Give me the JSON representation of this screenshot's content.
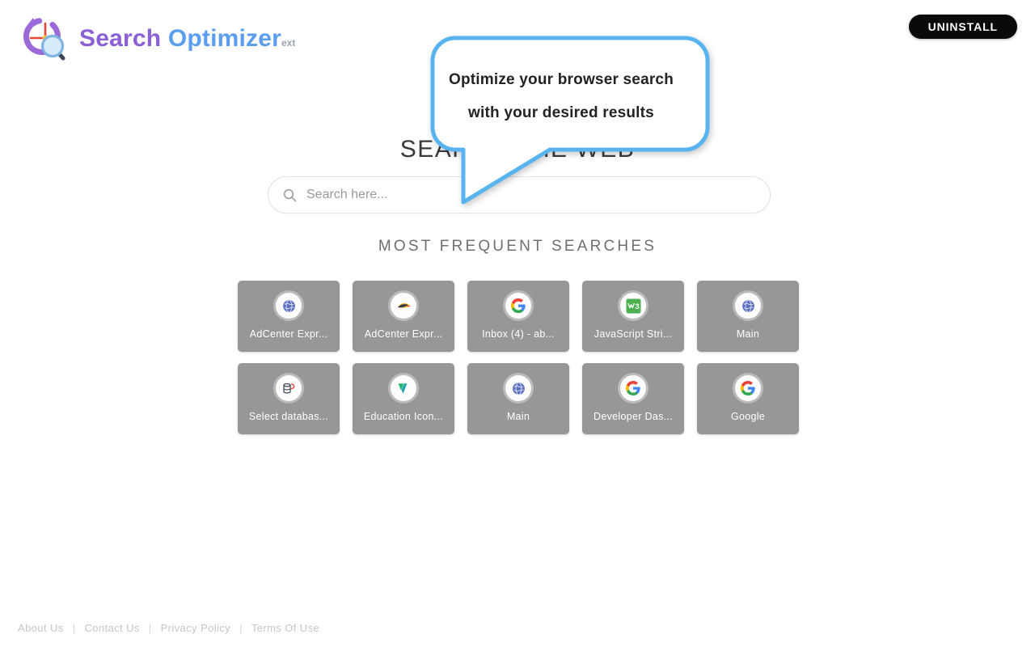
{
  "header": {
    "logo": {
      "icon_name": "search-history-logo-icon",
      "word1": "Search",
      "word2": "Optimizer",
      "suffix": "ext"
    },
    "uninstall_label": "UNINSTALL"
  },
  "tooltip": {
    "line1": "Optimize your browser search",
    "line2": "with your desired results",
    "border_color": "#58b4f0",
    "background": "#ffffff"
  },
  "main": {
    "heading": "SEARCH THE WEB",
    "search": {
      "placeholder": "Search here...",
      "value": "",
      "icon_name": "search-icon"
    },
    "frequent_heading": "MOST FREQUENT SEARCHES",
    "tiles": [
      {
        "label": "AdCenter Expr...",
        "icon": "globe-icon"
      },
      {
        "label": "AdCenter Expr...",
        "icon": "bird-icon"
      },
      {
        "label": "Inbox (4) - ab...",
        "icon": "google-g-icon"
      },
      {
        "label": "JavaScript Stri...",
        "icon": "w3schools-icon"
      },
      {
        "label": "Main",
        "icon": "globe-icon"
      },
      {
        "label": "Select databas...",
        "icon": "database-icon"
      },
      {
        "label": "Education Icon...",
        "icon": "vecteezy-v-icon"
      },
      {
        "label": "Main",
        "icon": "globe-icon"
      },
      {
        "label": "Developer Das...",
        "icon": "google-g-icon"
      },
      {
        "label": "Google",
        "icon": "google-g-icon"
      }
    ],
    "tile_background": "#979797"
  },
  "footer": {
    "links": [
      "About Us",
      "Contact Us",
      "Privacy Policy",
      "Terms Of Use"
    ],
    "separator": "|"
  }
}
